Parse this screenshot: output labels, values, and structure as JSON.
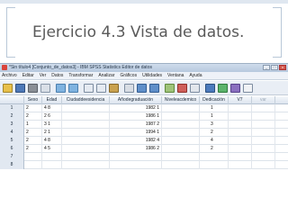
{
  "slide": {
    "title": "Ejercicio 4.3 Vista de datos."
  },
  "window": {
    "title": "*Sin título4 [Conjunto_de_datos3] - IBM SPSS Statistics Editor de datos",
    "buttons": [
      "_",
      "□",
      "x"
    ]
  },
  "menu": [
    "Archivo",
    "Editar",
    "Ver",
    "Datos",
    "Transformar",
    "Analizar",
    "Gráficos",
    "Utilidades",
    "Ventana",
    "Ayuda"
  ],
  "toolbar": {
    "icons": [
      "open-icon",
      "save-icon",
      "print-icon",
      "dialog-recall-icon",
      "undo-icon",
      "redo-icon",
      "goto-case-icon",
      "goto-variable-icon",
      "variables-icon",
      "find-icon",
      "insert-cases-icon",
      "insert-variable-icon",
      "split-file-icon",
      "weight-cases-icon",
      "select-cases-icon",
      "value-labels-icon",
      "use-sets-icon",
      "show-all-icon",
      "spell-check-icon"
    ]
  },
  "grid": {
    "columns": [
      "Sexo",
      "Edad",
      "Ciudaddeesidencia",
      "Añodegraduación",
      "Niveleacdemico",
      "Dedicación",
      "V7",
      "var"
    ],
    "rows": [
      {
        "n": "1",
        "cells": [
          "2",
          "4 8",
          "",
          "1982 1",
          "",
          "1",
          "",
          ""
        ]
      },
      {
        "n": "2",
        "cells": [
          "2",
          "2 6",
          "",
          "1986 1",
          "",
          "1",
          "",
          ""
        ]
      },
      {
        "n": "3",
        "cells": [
          "1",
          "3 1",
          "",
          "1987 2",
          "",
          "3",
          "",
          ""
        ]
      },
      {
        "n": "4",
        "cells": [
          "2",
          "2 1",
          "",
          "1994 1",
          "",
          "2",
          "",
          ""
        ]
      },
      {
        "n": "5",
        "cells": [
          "2",
          "4 8",
          "",
          "1982 4",
          "",
          "4",
          "",
          ""
        ]
      },
      {
        "n": "6",
        "cells": [
          "2",
          "4 5",
          "",
          "1986 2",
          "",
          "2",
          "",
          ""
        ]
      },
      {
        "n": "7",
        "cells": [
          "",
          "",
          "",
          "",
          "",
          "",
          "",
          ""
        ]
      },
      {
        "n": "8",
        "cells": [
          "",
          "",
          "",
          "",
          "",
          "",
          "",
          ""
        ]
      }
    ]
  },
  "colors": {
    "slide_title": "#5a5a5a",
    "titlebar": "#b7c9de",
    "menubar": "#eef2f8",
    "row_header": "#e1e8f1"
  }
}
